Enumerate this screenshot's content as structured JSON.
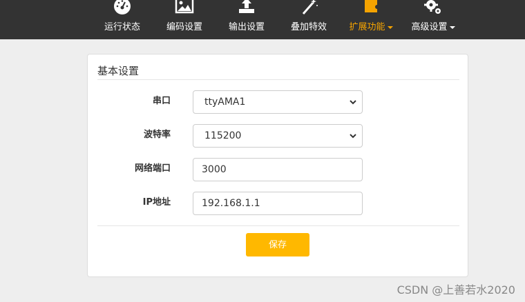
{
  "colors": {
    "navbar_bg": "#333333",
    "nav_text": "#ffffff",
    "nav_active": "#f5a300",
    "save_button": "#ffb800",
    "page_bg": "#eeeeee"
  },
  "nav": {
    "items": [
      {
        "label": "运行状态",
        "icon": "dashboard-icon"
      },
      {
        "label": "编码设置",
        "icon": "image-icon"
      },
      {
        "label": "输出设置",
        "icon": "upload-icon"
      },
      {
        "label": "叠加特效",
        "icon": "magic-wand-icon"
      },
      {
        "label": "扩展功能",
        "icon": "puzzle-icon",
        "active": true,
        "dropdown": true
      },
      {
        "label": "高级设置",
        "icon": "gears-icon",
        "dropdown": true
      }
    ]
  },
  "form": {
    "legend": "基本设置",
    "serial_port": {
      "label": "串口",
      "value": "ttyAMA1"
    },
    "baud_rate": {
      "label": "波特率",
      "value": "115200"
    },
    "network_port": {
      "label": "网络端口",
      "value": "3000"
    },
    "ip_address": {
      "label": "IP地址",
      "value": "192.168.1.1"
    },
    "save_label": "保存"
  },
  "watermark": "CSDN @上善若水2020"
}
